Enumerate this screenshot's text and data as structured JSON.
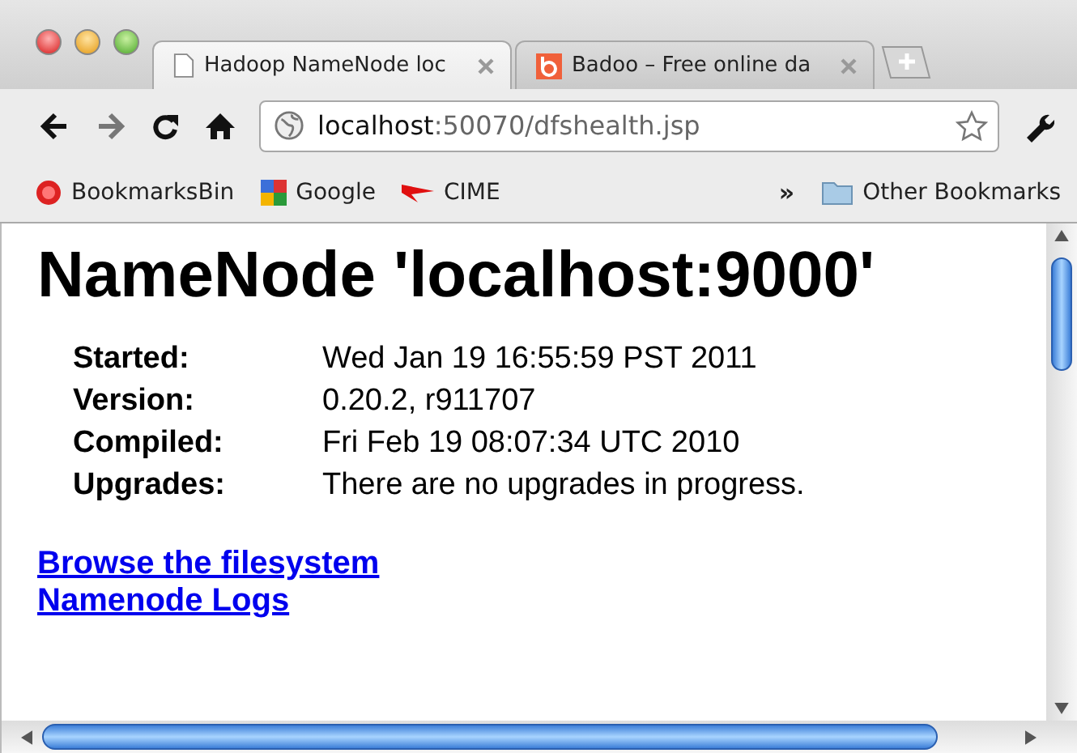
{
  "tabs": [
    {
      "title": "Hadoop NameNode loc",
      "kind": "page",
      "selected": true
    },
    {
      "title": "Badoo – Free online da",
      "kind": "badoo",
      "selected": false
    }
  ],
  "toolbar": {
    "address": {
      "host": "localhost",
      "rest": ":50070/dfshealth.jsp"
    }
  },
  "bookmarks": [
    {
      "label": "BookmarksBin",
      "kind": "bin"
    },
    {
      "label": "Google",
      "kind": "google"
    },
    {
      "label": "CIME",
      "kind": "cime"
    }
  ],
  "bookmarks_overflow": "»",
  "other_bookmarks": "Other Bookmarks",
  "page": {
    "heading": "NameNode 'localhost:9000'",
    "info": [
      {
        "label": "Started:",
        "value": "Wed Jan 19 16:55:59 PST 2011"
      },
      {
        "label": "Version:",
        "value": "0.20.2, r911707"
      },
      {
        "label": "Compiled:",
        "value": "Fri Feb 19 08:07:34 UTC 2010"
      },
      {
        "label": "Upgrades:",
        "value": "There are no upgrades in progress."
      }
    ],
    "links": [
      "Browse the filesystem",
      "Namenode Logs"
    ]
  }
}
